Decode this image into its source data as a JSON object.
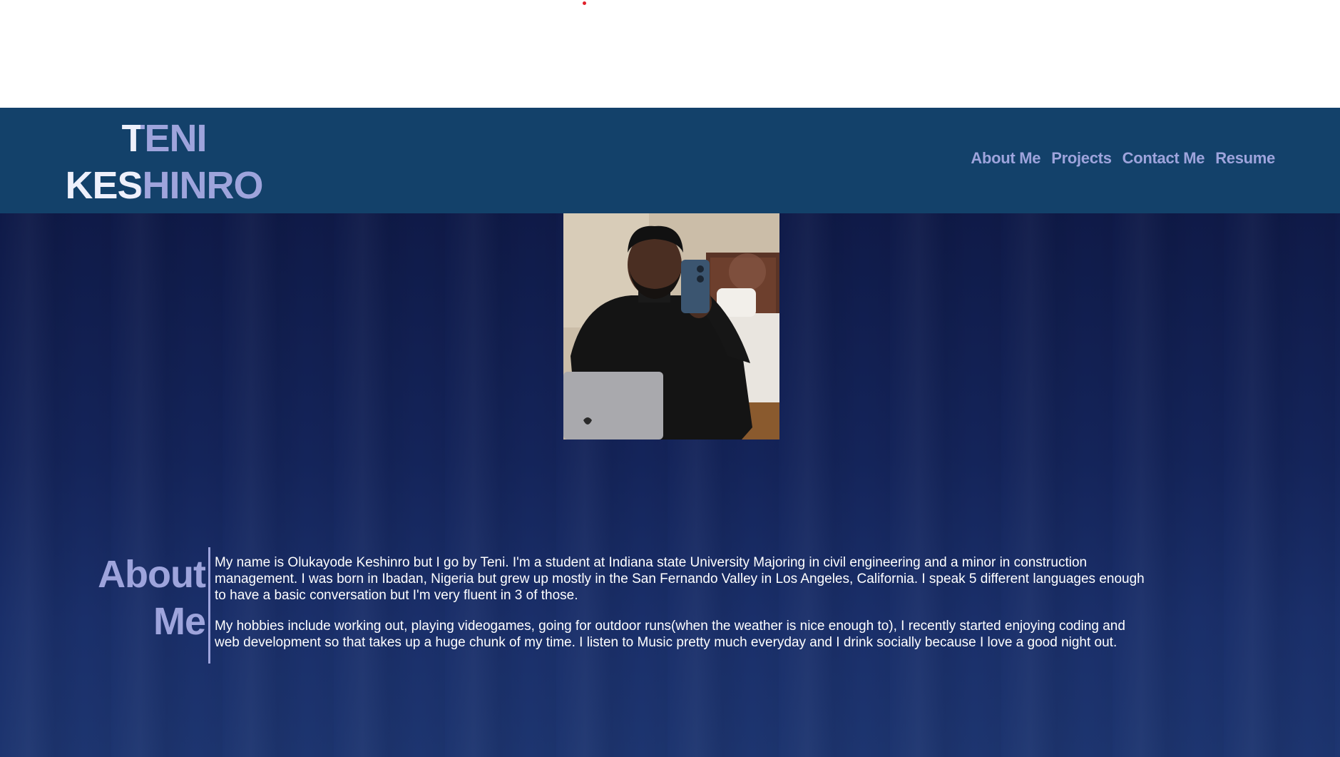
{
  "header": {
    "logo_line1": "TENI",
    "logo_line2": "KESHINRO",
    "nav": [
      {
        "label": "About Me"
      },
      {
        "label": "Projects"
      },
      {
        "label": "Contact Me"
      },
      {
        "label": "Resume"
      }
    ]
  },
  "about": {
    "heading_line1": "About",
    "heading_line2": "Me",
    "paragraphs": [
      "My name is Olukayode Keshinro but I go by Teni. I'm a student at Indiana state University Majoring in civil engineering and a minor in construction management. I was born in Ibadan, Nigeria but grew up mostly in the San Fernando Valley in Los Angeles, California. I speak 5 different languages enough to have a basic conversation but I'm very fluent in 3 of those.",
      "My hobbies include working out, playing videogames, going for outdoor runs(when the weather is nice enough to), I recently started enjoying coding and web development so that takes up a huge chunk of my time. I listen to Music pretty much everyday and I drink socially because I love a good night out."
    ]
  },
  "colors": {
    "header_bg": "#13416a",
    "accent": "#9ea4dc",
    "logo_light": "#eef0fb",
    "page_bg": "#14245a"
  },
  "icons": {
    "photo": "profile-photo"
  }
}
